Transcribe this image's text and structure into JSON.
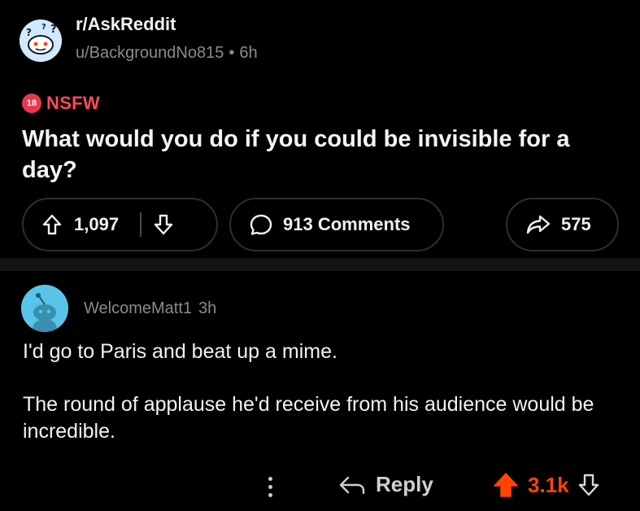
{
  "post": {
    "subreddit": "r/AskReddit",
    "author": "u/BackgroundNo815",
    "separator": "•",
    "age": "6h",
    "nsfw_badge": "18",
    "nsfw_label": "NSFW",
    "title": "What would you do if you could be invisible for a day?",
    "score": "1,097",
    "comments_label": "913 Comments",
    "shares": "575"
  },
  "comment": {
    "author": "WelcomeMatt1",
    "age": "3h",
    "body": [
      "I'd go to Paris and beat up a mime.",
      "The round of applause he'd receive from his audience would be incredible."
    ],
    "reply_label": "Reply",
    "score": "3.1k"
  },
  "colors": {
    "background": "#000000",
    "nsfw": "#ff4a5b",
    "upvote_active": "#ff4500",
    "muted_text": "#8b8b8b"
  },
  "icons": [
    "snoo-question-avatar",
    "upvote-icon",
    "downvote-icon",
    "comment-bubble-icon",
    "share-arrow-icon",
    "snoo-avatar",
    "more-options-icon",
    "reply-arrow-icon"
  ]
}
